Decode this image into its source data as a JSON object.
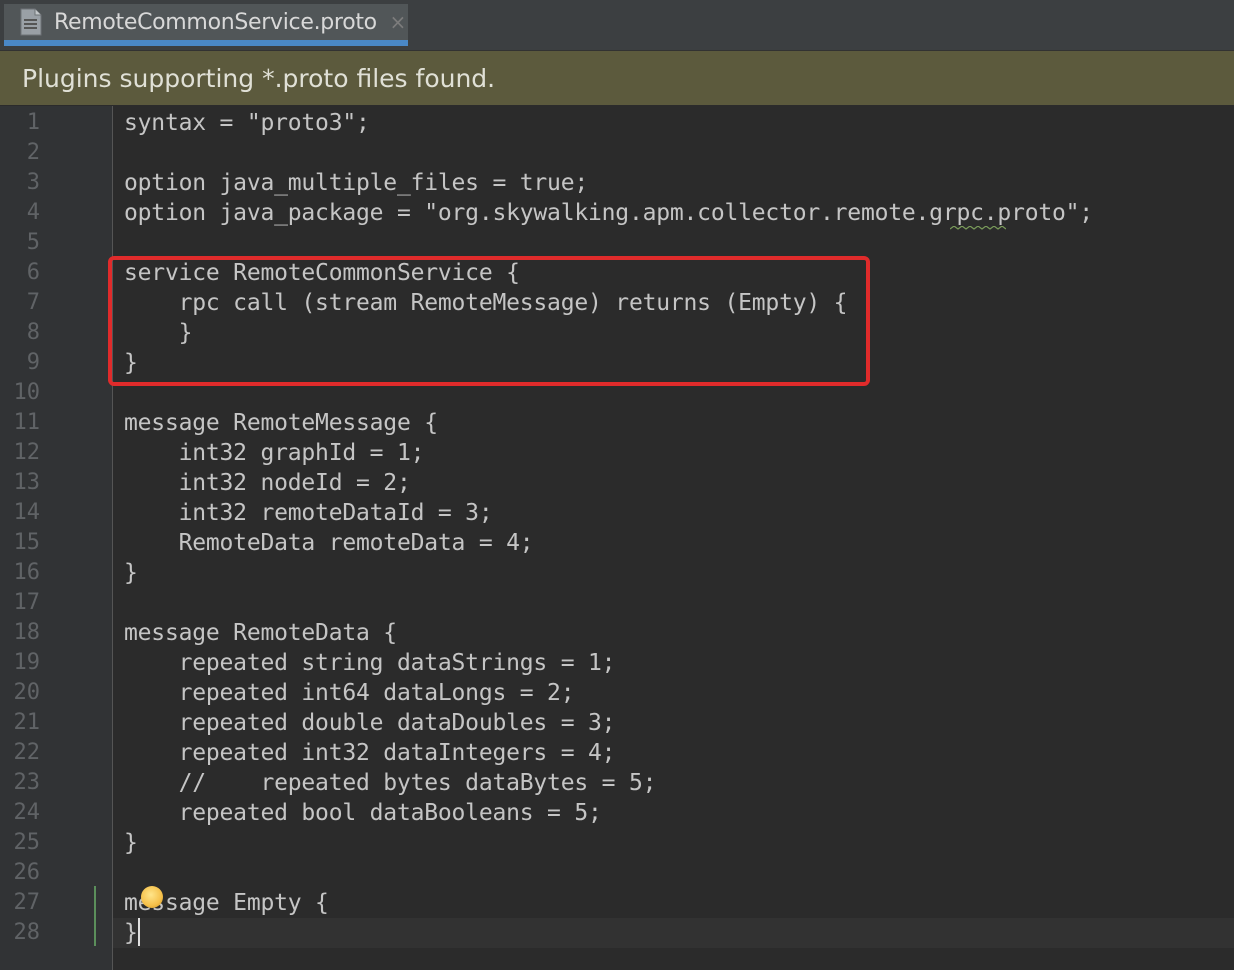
{
  "tab": {
    "title": "RemoteCommonService.proto",
    "close_symbol": "×"
  },
  "banner": {
    "message": "Plugins supporting *.proto files found."
  },
  "editor": {
    "lines": [
      "syntax = \"proto3\";",
      "",
      "option java_multiple_files = true;",
      "option java_package = \"org.skywalking.apm.collector.remote.grpc.proto\";",
      "",
      "service RemoteCommonService {",
      "    rpc call (stream RemoteMessage) returns (Empty) {",
      "    }",
      "}",
      "",
      "message RemoteMessage {",
      "    int32 graphId = 1;",
      "    int32 nodeId = 2;",
      "    int32 remoteDataId = 3;",
      "    RemoteData remoteData = 4;",
      "}",
      "",
      "message RemoteData {",
      "    repeated string dataStrings = 1;",
      "    repeated int64 dataLongs = 2;",
      "    repeated double dataDoubles = 3;",
      "    repeated int32 dataIntegers = 4;",
      "    //    repeated bytes dataBytes = 5;",
      "    repeated bool dataBooleans = 5;",
      "}",
      "",
      "message Empty {",
      "}"
    ],
    "line_numbers": [
      "1",
      "2",
      "3",
      "4",
      "5",
      "6",
      "7",
      "8",
      "9",
      "10",
      "11",
      "12",
      "13",
      "14",
      "15",
      "16",
      "17",
      "18",
      "19",
      "20",
      "21",
      "22",
      "23",
      "24",
      "25",
      "26",
      "27",
      "28"
    ],
    "current_line": 28
  },
  "colors": {
    "background": "#2b2b2b",
    "gutter": "#313335",
    "banner": "#5c5a3d",
    "tab_accent": "#4a88c7",
    "highlight_box": "#e02b2b",
    "text": "#c5c5c5",
    "line_number": "#606366"
  },
  "icons": {
    "tab_file": "file-icon",
    "intention": "lightbulb-icon"
  }
}
